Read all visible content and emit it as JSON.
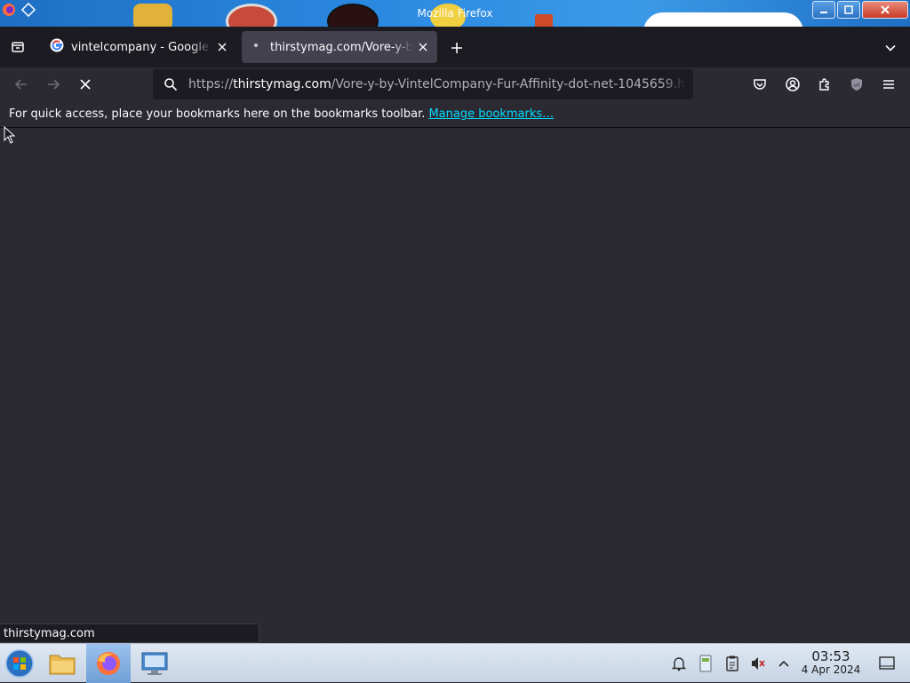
{
  "window": {
    "title": "Mozilla Firefox"
  },
  "tabs": [
    {
      "title": "vintelcompany - Google Search",
      "favicon": "google-icon",
      "active": false
    },
    {
      "title": "thirstymag.com/Vore-y-by-VintelCompany",
      "favicon": "loading-dot-icon",
      "active": true
    }
  ],
  "navbar": {
    "url_prefix": "https://",
    "url_host": "thirstymag.com",
    "url_path": "/Vore-y-by-VintelCompany-Fur-Affinity-dot-net-1045659.h",
    "toolbar_icons": [
      "pocket-icon",
      "account-icon",
      "extensions-icon",
      "ublock-icon",
      "menu-icon"
    ]
  },
  "bookmarks_bar": {
    "message": "For quick access, place your bookmarks here on the bookmarks toolbar.",
    "link_text": "Manage bookmarks…"
  },
  "status_panel": {
    "text": "thirstymag.com"
  },
  "taskbar": {
    "items": [
      "start-orb-icon",
      "file-manager-icon",
      "firefox-icon",
      "remote-desktop-icon"
    ],
    "tray_icons": [
      "notifications-icon",
      "network-icon",
      "clipboard-icon",
      "volume-muted-icon",
      "tray-expand-icon"
    ],
    "clock": {
      "time": "03:53",
      "date": "4 Apr 2024"
    }
  },
  "colors": {
    "toolbar_bg": "#2b2a33",
    "tabstrip_bg": "#1c1b22",
    "active_tab_bg": "#42414d",
    "link": "#00ddff",
    "titlebar": "#2a88e0"
  }
}
